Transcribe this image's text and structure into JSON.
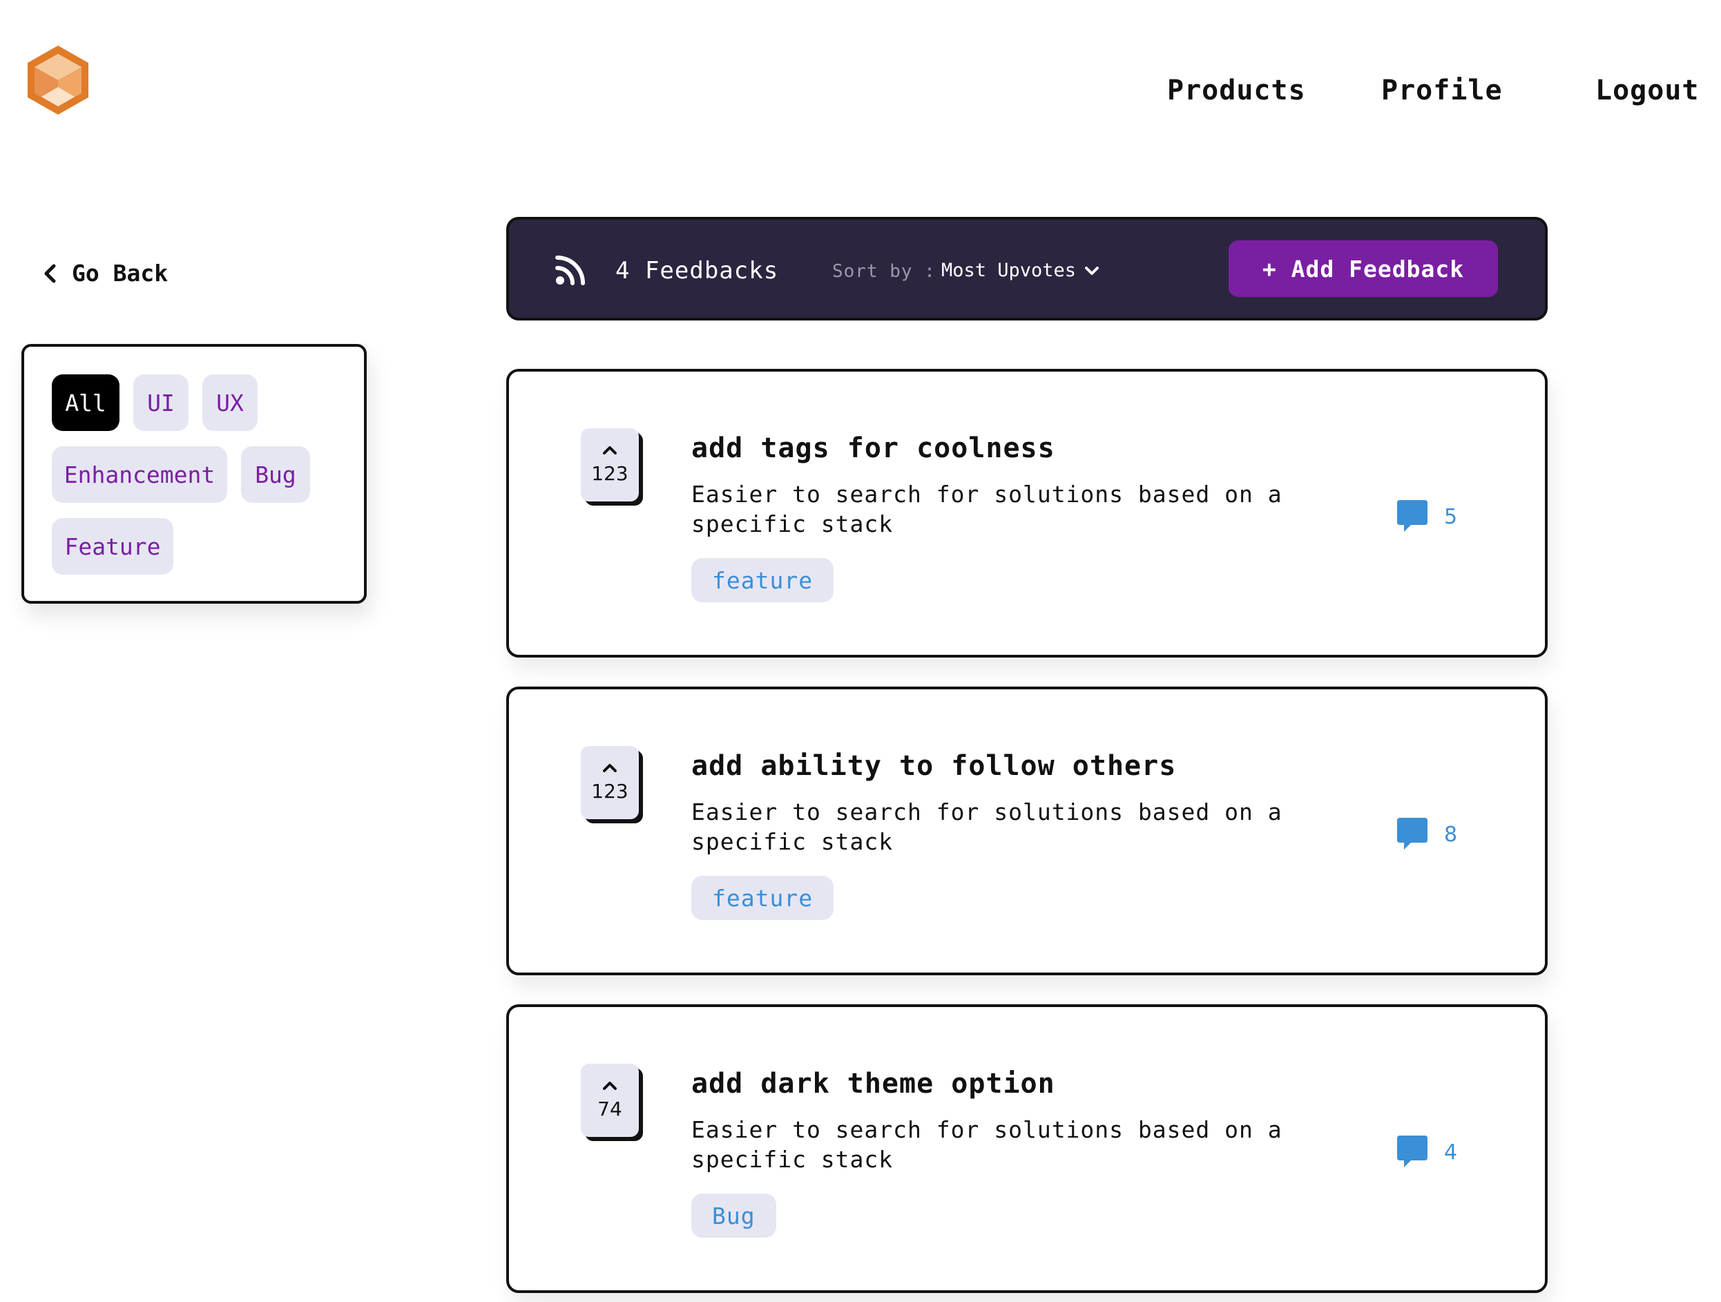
{
  "header": {
    "logo_icon": "hexagon-cube-logo-icon",
    "nav": [
      "Products",
      "Profile",
      "Logout"
    ]
  },
  "sidebar": {
    "go_back": "Go Back",
    "filters": [
      {
        "label": "All",
        "active": true
      },
      {
        "label": "UI",
        "active": false
      },
      {
        "label": "UX",
        "active": false
      },
      {
        "label": "Enhancement",
        "active": false
      },
      {
        "label": "Bug",
        "active": false
      },
      {
        "label": "Feature",
        "active": false
      }
    ]
  },
  "toolbar": {
    "icon": "rss-icon",
    "count": "4 Feedbacks",
    "sort_label": "Sort by :",
    "sort_value": "Most Upvotes",
    "add_button": "+ Add Feedback"
  },
  "feedbacks": [
    {
      "upvotes": "123",
      "title": "add tags for coolness",
      "description": "Easier to search for solutions based on a specific stack",
      "tag": "feature",
      "comments": "5"
    },
    {
      "upvotes": "123",
      "title": "add ability to follow others",
      "description": "Easier to search for solutions based on a specific stack",
      "tag": "feature",
      "comments": "8"
    },
    {
      "upvotes": "74",
      "title": "add dark theme option",
      "description": "Easier to search for solutions based on a specific stack",
      "tag": "Bug",
      "comments": "4"
    }
  ],
  "colors": {
    "accent": "#7a1fa2",
    "toolbar_bg": "#2c2540",
    "chip_bg": "#e6e6f3",
    "link_blue": "#3b8fd6",
    "logo_orange": "#e07b28"
  }
}
